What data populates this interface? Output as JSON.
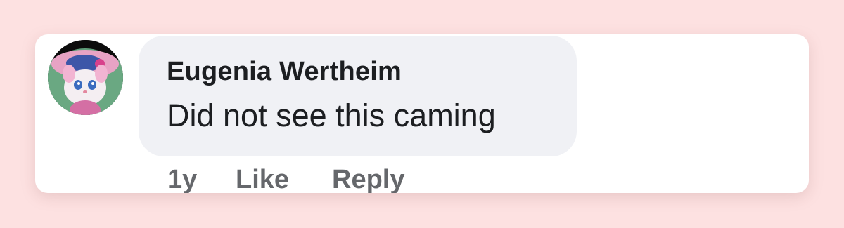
{
  "comment": {
    "author": "Eugenia Wertheim",
    "text": "Did not see this caming",
    "timestamp": "1y",
    "actions": {
      "like_label": "Like",
      "reply_label": "Reply"
    },
    "avatar_icon": "avatar-cartoon-cat-icon"
  },
  "colors": {
    "background": "#fde1e1",
    "card": "#ffffff",
    "bubble": "#f0f1f5",
    "text_primary": "#1c1e21",
    "text_secondary": "#65676b"
  }
}
